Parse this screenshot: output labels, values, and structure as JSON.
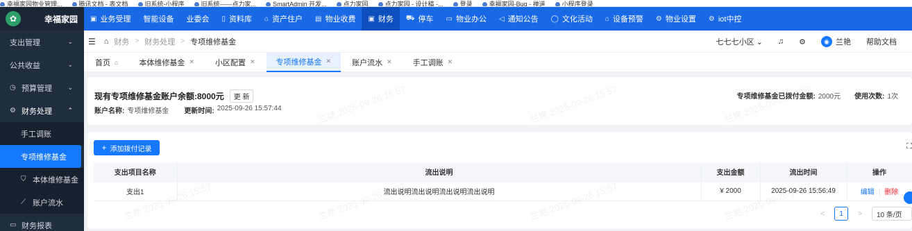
{
  "bookmarks": [
    "幸福家园物业管理...",
    "腾讯文档 - 表文档",
    "旧系统-小程序",
    "旧系统——点力家...",
    "SmartAdmin 开发...",
    "点力家园",
    "点力家园 - 设计稿 -...",
    "登录",
    "幸福家园-Bug - 禅道",
    "小程序登录"
  ],
  "sidebar": {
    "app_name": "幸福家园",
    "logo_icon": "gear-flower-logo",
    "items": [
      {
        "label": "支出管理",
        "icon": "",
        "arrow": "⌄"
      },
      {
        "label": "公共收益",
        "icon": "",
        "arrow": "⌄"
      },
      {
        "label": "预算管理",
        "icon": "clock-icon",
        "arrow": "⌄"
      },
      {
        "label": "财务处理",
        "icon": "gear-icon",
        "arrow": "⌃"
      }
    ],
    "sub_items": [
      {
        "label": "手工调账"
      },
      {
        "label": "专项维修基金"
      },
      {
        "label": "本体维修基金",
        "icon": "shield-icon"
      },
      {
        "label": "账户流水",
        "icon": "chart-icon"
      }
    ],
    "bottom_item": {
      "label": "财务报表",
      "icon": "report-icon"
    }
  },
  "topnav": {
    "items": [
      {
        "label": "业务受理",
        "icon": "▣"
      },
      {
        "label": "智能设备",
        "icon": ""
      },
      {
        "label": "业委会",
        "icon": ""
      },
      {
        "label": "资料库",
        "icon": "▯"
      },
      {
        "label": "资产住户",
        "icon": "⌂"
      },
      {
        "label": "物业收费",
        "icon": "▤"
      },
      {
        "label": "财务",
        "icon": "▣"
      },
      {
        "label": "停车",
        "icon": "⛟"
      },
      {
        "label": "物业办公",
        "icon": "▭"
      },
      {
        "label": "通知公告",
        "icon": "◁"
      },
      {
        "label": "文化活动",
        "icon": "◯"
      },
      {
        "label": "设备预警",
        "icon": "⌂"
      },
      {
        "label": "物业设置",
        "icon": "⚙"
      },
      {
        "label": "iot中控",
        "icon": "⚙"
      }
    ]
  },
  "breadcrumb": {
    "items": [
      "财务",
      "财务处理",
      "专项维修基金"
    ],
    "separator": ">"
  },
  "header_right": {
    "community": "七七七小区",
    "user": "兰艳",
    "avatar_text": "◉",
    "help": "帮助文档"
  },
  "tabs": [
    {
      "label": "首页",
      "icon": "⌂"
    },
    {
      "label": "本体维修基金"
    },
    {
      "label": "小区配置"
    },
    {
      "label": "专项维修基金"
    },
    {
      "label": "账户流水"
    },
    {
      "label": "手工调账"
    }
  ],
  "info": {
    "balance_label": "现有专项维修基金账户余额:",
    "balance_value": "8000元",
    "refresh_label": "更 新",
    "account_name_label": "账户名称:",
    "account_name_value": "专项维修基金",
    "update_time_label": "更新时间:",
    "update_time_value": "2025-09-26 15:57:44",
    "paid_label": "专项维修基金已拨付金额:",
    "paid_value": "2000元",
    "use_count_label": "使用次数:",
    "use_count_value": "1次"
  },
  "table": {
    "add_button": "添加拨付记录",
    "columns": [
      "支出项目名称",
      "流出说明",
      "支出金额",
      "流出时间",
      "操作"
    ],
    "rows": [
      {
        "name": "支出1",
        "desc": "流出说明流出说明流出说明流出说明",
        "amount": "¥ 2000",
        "time": "2025-09-26 15:56:49",
        "edit": "编辑",
        "delete": "删除"
      }
    ]
  },
  "pager": {
    "prev": "<",
    "page": "1",
    "next": ">",
    "page_size": "10 条/页"
  },
  "watermark": "兰艳 2025-09-26 15:57",
  "colors": {
    "primary": "#1677ff",
    "nav": "#1968e6",
    "sidebar": "#1f2d3d",
    "danger": "#f5222d"
  }
}
